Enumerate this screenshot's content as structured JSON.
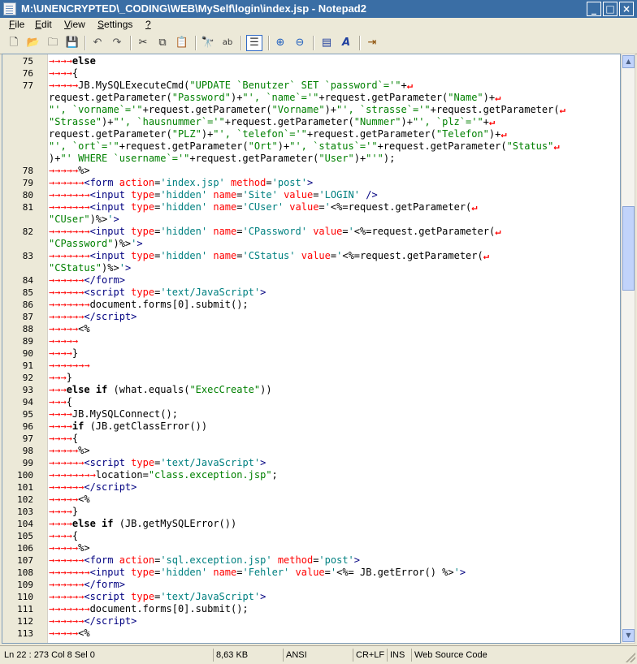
{
  "window": {
    "title": "M:\\UNENCRYPTED\\_CODING\\WEB\\MySelf\\login\\index.jsp - Notepad2",
    "controls": {
      "minimize": "_",
      "maximize": "□",
      "close": "×"
    }
  },
  "menu": [
    {
      "underline": "F",
      "rest": "ile"
    },
    {
      "underline": "E",
      "rest": "dit"
    },
    {
      "underline": "V",
      "rest": "iew"
    },
    {
      "underline": "S",
      "rest": "ettings"
    },
    {
      "underline": "?",
      "rest": ""
    }
  ],
  "toolbar_icons": [
    "new-file-icon",
    "open-file-icon",
    "browse-icon",
    "save-icon",
    "undo-icon",
    "redo-icon",
    "cut-icon",
    "copy-icon",
    "paste-icon",
    "find-icon",
    "replace-icon",
    "word-wrap-icon",
    "zoom-in-icon",
    "zoom-out-icon",
    "scheme-icon",
    "font-icon",
    "exit-icon"
  ],
  "code_lines": [
    {
      "n": "75",
      "t": 4,
      "h": "<span class='kw'>else</span>"
    },
    {
      "n": "76",
      "t": 4,
      "h": "{"
    },
    {
      "n": "77",
      "t": 5,
      "h": "JB.MySQLExecuteCmd(<span class='str'>\"UPDATE `Benutzer` SET `password`='\"</span>+<span class='wrap'>↵</span>"
    },
    {
      "n": "",
      "t": 0,
      "h": "request.getParameter(<span class='str'>\"Password\"</span>)+<span class='str'>\"', `name`='\"</span>+request.getParameter(<span class='str'>\"Name\"</span>)+<span class='wrap'>↵</span>"
    },
    {
      "n": "",
      "t": 0,
      "h": "<span class='str'>\"', `vorname`='\"</span>+request.getParameter(<span class='str'>\"Vorname\"</span>)+<span class='str'>\"', `strasse`='\"</span>+request.getParameter(<span class='wrap'>↵</span>"
    },
    {
      "n": "",
      "t": 0,
      "h": "<span class='str'>\"Strasse\"</span>)+<span class='str'>\"', `hausnummer`='\"</span>+request.getParameter(<span class='str'>\"Nummer\"</span>)+<span class='str'>\"', `plz`='\"</span>+<span class='wrap'>↵</span>"
    },
    {
      "n": "",
      "t": 0,
      "h": "request.getParameter(<span class='str'>\"PLZ\"</span>)+<span class='str'>\"', `telefon`='\"</span>+request.getParameter(<span class='str'>\"Telefon\"</span>)+<span class='wrap'>↵</span>"
    },
    {
      "n": "",
      "t": 0,
      "h": "<span class='str'>\"', `ort`='\"</span>+request.getParameter(<span class='str'>\"Ort\"</span>)+<span class='str'>\"', `status`='\"</span>+request.getParameter(<span class='str'>\"Status\"</span><span class='wrap'>↵</span>"
    },
    {
      "n": "",
      "t": 0,
      "h": ")+<span class='str'>\"' WHERE `username`='\"</span>+request.getParameter(<span class='str'>\"User\"</span>)+<span class='str'>\"'\"</span>);"
    },
    {
      "n": "78",
      "t": 5,
      "h": "%>"
    },
    {
      "n": "79",
      "t": 6,
      "h": "<span class='tag'>&lt;form</span> <span class='attr'>action</span>=<span class='aval'>'index.jsp'</span> <span class='attr'>method</span>=<span class='aval'>'post'</span><span class='tag'>&gt;</span>"
    },
    {
      "n": "80",
      "t": 7,
      "h": "<span class='tag'>&lt;input</span> <span class='attr'>type</span>=<span class='aval'>'hidden'</span> <span class='attr'>name</span>=<span class='aval'>'Site'</span> <span class='attr'>value</span>=<span class='aval'>'LOGIN'</span> <span class='tag'>/&gt;</span>"
    },
    {
      "n": "81",
      "t": 7,
      "h": "<span class='tag'>&lt;input</span> <span class='attr'>type</span>=<span class='aval'>'hidden'</span> <span class='attr'>name</span>=<span class='aval'>'CUser'</span> <span class='attr'>value</span>=<span class='aval'>'</span>&lt;%=request.getParameter(<span class='wrap'>↵</span>"
    },
    {
      "n": "",
      "t": 0,
      "h": "<span class='str'>\"CUser\"</span>)%&gt;<span class='aval'>'</span><span class='tag'>&gt;</span>"
    },
    {
      "n": "82",
      "t": 7,
      "h": "<span class='tag'>&lt;input</span> <span class='attr'>type</span>=<span class='aval'>'hidden'</span> <span class='attr'>name</span>=<span class='aval'>'CPassword'</span> <span class='attr'>value</span>=<span class='aval'>'</span>&lt;%=request.getParameter(<span class='wrap'>↵</span>"
    },
    {
      "n": "",
      "t": 0,
      "h": "<span class='str'>\"CPassword\"</span>)%&gt;<span class='aval'>'</span><span class='tag'>&gt;</span>"
    },
    {
      "n": "83",
      "t": 7,
      "h": "<span class='tag'>&lt;input</span> <span class='attr'>type</span>=<span class='aval'>'hidden'</span> <span class='attr'>name</span>=<span class='aval'>'CStatus'</span> <span class='attr'>value</span>=<span class='aval'>'</span>&lt;%=request.getParameter(<span class='wrap'>↵</span>"
    },
    {
      "n": "",
      "t": 0,
      "h": "<span class='str'>\"CStatus\"</span>)%&gt;<span class='aval'>'</span><span class='tag'>&gt;</span>"
    },
    {
      "n": "84",
      "t": 6,
      "h": "<span class='tag'>&lt;/form&gt;</span>"
    },
    {
      "n": "85",
      "t": 6,
      "h": "<span class='tag'>&lt;script</span> <span class='attr'>type</span>=<span class='aval'>'text/JavaScript'</span><span class='tag'>&gt;</span>"
    },
    {
      "n": "86",
      "t": 7,
      "h": "document.forms[0].submit();"
    },
    {
      "n": "87",
      "t": 6,
      "h": "<span class='tag'>&lt;/script&gt;</span>"
    },
    {
      "n": "88",
      "t": 5,
      "h": "&lt;%"
    },
    {
      "n": "89",
      "t": 5,
      "h": ""
    },
    {
      "n": "90",
      "t": 4,
      "h": "}"
    },
    {
      "n": "91",
      "t": 7,
      "h": ""
    },
    {
      "n": "92",
      "t": 3,
      "h": "}"
    },
    {
      "n": "93",
      "t": 3,
      "h": "<span class='kw'>else</span> <span class='kw'>if</span> (what.equals(<span class='str'>\"ExecCreate\"</span>))"
    },
    {
      "n": "94",
      "t": 3,
      "h": "{"
    },
    {
      "n": "95",
      "t": 4,
      "h": "JB.MySQLConnect();"
    },
    {
      "n": "96",
      "t": 4,
      "h": "<span class='kw'>if</span> (JB.getClassError())"
    },
    {
      "n": "97",
      "t": 4,
      "h": "{"
    },
    {
      "n": "98",
      "t": 5,
      "h": "%>"
    },
    {
      "n": "99",
      "t": 6,
      "h": "<span class='tag'>&lt;script</span> <span class='attr'>type</span>=<span class='aval'>'text/JavaScript'</span><span class='tag'>&gt;</span>"
    },
    {
      "n": "100",
      "t": 8,
      "h": "location=<span class='str'>\"class.exception.jsp\"</span>;"
    },
    {
      "n": "101",
      "t": 6,
      "h": "<span class='tag'>&lt;/script&gt;</span>"
    },
    {
      "n": "102",
      "t": 5,
      "h": "&lt;%"
    },
    {
      "n": "103",
      "t": 4,
      "h": "}"
    },
    {
      "n": "104",
      "t": 4,
      "h": "<span class='kw'>else</span> <span class='kw'>if</span> (JB.getMySQLError())"
    },
    {
      "n": "105",
      "t": 4,
      "h": "{"
    },
    {
      "n": "106",
      "t": 5,
      "h": "%>"
    },
    {
      "n": "107",
      "t": 6,
      "h": "<span class='tag'>&lt;form</span> <span class='attr'>action</span>=<span class='aval'>'sql.exception.jsp'</span> <span class='attr'>method</span>=<span class='aval'>'post'</span><span class='tag'>&gt;</span>"
    },
    {
      "n": "108",
      "t": 7,
      "h": "<span class='tag'>&lt;input</span> <span class='attr'>type</span>=<span class='aval'>'hidden'</span> <span class='attr'>name</span>=<span class='aval'>'Fehler'</span> <span class='attr'>value</span>=<span class='aval'>'</span>&lt;%= JB.getError() %&gt;<span class='aval'>'</span><span class='tag'>&gt;</span>"
    },
    {
      "n": "109",
      "t": 6,
      "h": "<span class='tag'>&lt;/form&gt;</span>"
    },
    {
      "n": "110",
      "t": 6,
      "h": "<span class='tag'>&lt;script</span> <span class='attr'>type</span>=<span class='aval'>'text/JavaScript'</span><span class='tag'>&gt;</span>"
    },
    {
      "n": "111",
      "t": 7,
      "h": "document.forms[0].submit();"
    },
    {
      "n": "112",
      "t": 6,
      "h": "<span class='tag'>&lt;/script&gt;</span>"
    },
    {
      "n": "113",
      "t": 5,
      "h": "&lt;%"
    }
  ],
  "statusbar": {
    "position": "Ln 22 : 273   Col 8   Sel 0",
    "size": "8,63 KB",
    "encoding": "ANSI",
    "eol": "CR+LF",
    "mode": "INS",
    "scheme": "Web Source Code"
  },
  "colors": {
    "titlebar": "#3a6ea5",
    "tab_marker": "#ff0000",
    "string": "#008000"
  }
}
